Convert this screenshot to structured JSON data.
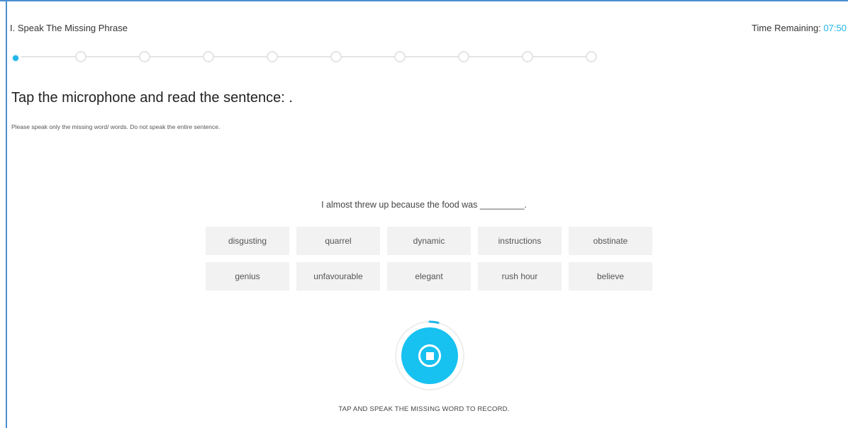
{
  "header": {
    "title": "I. Speak The Missing Phrase",
    "timer_label": "Time Remaining: ",
    "timer_value": "07:50"
  },
  "stepper": {
    "total_steps": 10,
    "current_step": 1
  },
  "question": {
    "instruction": "Tap the microphone and read the sentence: .",
    "note": "Please speak only the missing word/ words. Do not speak the entire sentence.",
    "sentence": "I almost threw up because the food was _________."
  },
  "options": [
    "disgusting",
    "quarrel",
    "dynamic",
    "instructions",
    "obstinate",
    "genius",
    "unfavourable",
    "elegant",
    "rush hour",
    "believe"
  ],
  "recorder": {
    "icon": "stop-icon",
    "label": "TAP AND SPEAK THE MISSING WORD TO RECORD."
  },
  "colors": {
    "accent": "#1fb6e8",
    "mic_button": "#17c1f0",
    "frame": "#4a8fd0",
    "option_bg": "#f2f2f2"
  }
}
